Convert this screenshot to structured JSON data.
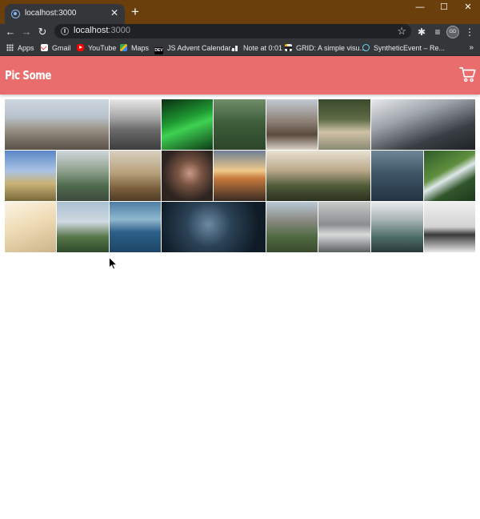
{
  "browser": {
    "tab_title": "localhost:3000",
    "tab_close": "✕",
    "new_tab": "+",
    "window_controls": {
      "minimize": "—",
      "maximize": "☐",
      "close": "✕"
    },
    "nav": {
      "back": "←",
      "forward": "→",
      "reload": "↻"
    },
    "address": {
      "host": "localhost",
      "port": ":3000"
    },
    "star": "☆",
    "toolbar_icons": {
      "extensions": "✱",
      "media": "≡",
      "menu": "⋮"
    },
    "profile_initials": "GD",
    "bookmarks": [
      {
        "label": "Apps",
        "icon": "apps-grid"
      },
      {
        "label": "Gmail",
        "icon": "gmail-icon"
      },
      {
        "label": "YouTube",
        "icon": "youtube-icon"
      },
      {
        "label": "Maps",
        "icon": "maps-icon"
      },
      {
        "label": "JS Advent Calendar...",
        "icon": "dev-icon",
        "icon_text": "DEV"
      },
      {
        "label": "Note at 0:01",
        "icon": "note-icon"
      },
      {
        "label": "GRID: A simple visu...",
        "icon": "grid-icon"
      },
      {
        "label": "SyntheticEvent – Re...",
        "icon": "react-icon"
      }
    ],
    "bookmarks_overflow": "»"
  },
  "app": {
    "brand": "Pic Some",
    "header_color": "#e96d6d",
    "cart_icon": "shopping-cart-icon"
  },
  "gallery": {
    "photos": [
      {
        "name": "photo-bear-on-rocks",
        "g": "linear-gradient(180deg,#cfd8e0 0%,#b8c2cc 35%,#9a9286 60%,#6f665c 85%,#5a5249 100%)"
      },
      {
        "name": "photo-foggy-trees",
        "g": "linear-gradient(180deg,#e6e6e6 0%,#a9a9a9 35%,#6b6b6b 60%,#3d3d3d 100%)"
      },
      {
        "name": "photo-green-aurora",
        "g": "linear-gradient(160deg,#0a2e12 0%,#1f9a32 40%,#3fd152 55%,#0d3a16 100%)"
      },
      {
        "name": "photo-pine-forest",
        "g": "linear-gradient(180deg,#6f8d69 0%,#3f5e3b 45%,#2b4529 100%)"
      },
      {
        "name": "photo-eagle-flying",
        "g": "linear-gradient(180deg,#c2c9d3 0%,#8b7e72 45%,#5a4a3d 70%,#d9d0c5 100%)"
      },
      {
        "name": "photo-pug-blanket",
        "g": "linear-gradient(180deg,#3b4a2c 0%,#5f6b46 40%,#cfc2a6 65%,#8a8a73 100%)"
      },
      {
        "name": "photo-skyscraper",
        "g": "linear-gradient(160deg,#e7e9ec 0%,#9ea4ab 35%,#3a3f45 70%,#1e2226 100%)"
      },
      {
        "name": "photo-sneakers-field",
        "g": "linear-gradient(180deg,#5b87c7 0%,#a9c3e4 40%,#c9b377 65%,#7a6a3a 100%)"
      },
      {
        "name": "photo-city-aerial",
        "g": "linear-gradient(180deg,#cfd6db 0%,#8fa08e 40%,#4f6a4c 70%,#3e4a40 100%)"
      },
      {
        "name": "photo-dry-grass-sunset",
        "g": "linear-gradient(180deg,#d8d0c0 0%,#b7a07a 45%,#7a5f3d 75%,#4d3b25 100%)"
      },
      {
        "name": "photo-woman-portrait",
        "g": "radial-gradient(circle at 55% 45%,#c99a85 0%,#7a5443 30%,#2d2420 70%)"
      },
      {
        "name": "photo-sunrise-road",
        "g": "linear-gradient(180deg,#6d7f95 0%,#f0c98a 40%,#c77a3d 55%,#3a2a22 100%)"
      },
      {
        "name": "photo-valley-forest",
        "g": "linear-gradient(180deg,#e8e1d2 0%,#b9a789 40%,#4f5a38 70%,#2b3220 100%)"
      },
      {
        "name": "photo-ocean-boat",
        "g": "linear-gradient(180deg,#6f8696 0%,#3e5566 45%,#233444 100%)"
      },
      {
        "name": "photo-waterfall-cliff",
        "g": "linear-gradient(150deg,#2f5b2a 0%,#5f8f3f 40%,#dfe8ea 52%,#31562b 70%,#1d3a1c 100%)"
      },
      {
        "name": "photo-dreamcatcher",
        "g": "linear-gradient(160deg,#fbf5e4 0%,#efdcb6 45%,#cbb48a 100%)"
      },
      {
        "name": "photo-castle-hill",
        "g": "linear-gradient(180deg,#a9c0d2 0%,#cfd9e0 40%,#567548 70%,#2f4a2c 100%)"
      },
      {
        "name": "photo-ocean-waves",
        "g": "linear-gradient(180deg,#4c7da4 0%,#90b8d0 35%,#2d6088 60%,#1d4566 100%)"
      },
      {
        "name": "photo-star-trails",
        "g": "radial-gradient(circle at 45% 45%,#6b8aa3 0%,#2b4256 35%,#0f1b26 80%)"
      },
      {
        "name": "photo-yosemite-valley",
        "g": "linear-gradient(180deg,#b9c9d6 0%,#8c8c86 35%,#4f6a40 70%,#3a4a2d 100%)"
      },
      {
        "name": "photo-rocky-river",
        "g": "linear-gradient(180deg,#c8c8c8 0%,#8a8e8f 45%,#d9dbdb 65%,#5b5f60 100%)"
      },
      {
        "name": "photo-misty-mountains",
        "g": "linear-gradient(180deg,#e9eced 0%,#a9b4b5 35%,#4d6d6a 70%,#2a3a38 100%)"
      },
      {
        "name": "photo-sea-stack",
        "g": "linear-gradient(180deg,#f0f0f0 0%,#d2d2d2 50%,#3a3a3a 65%,#e8e8e8 100%)"
      }
    ]
  }
}
